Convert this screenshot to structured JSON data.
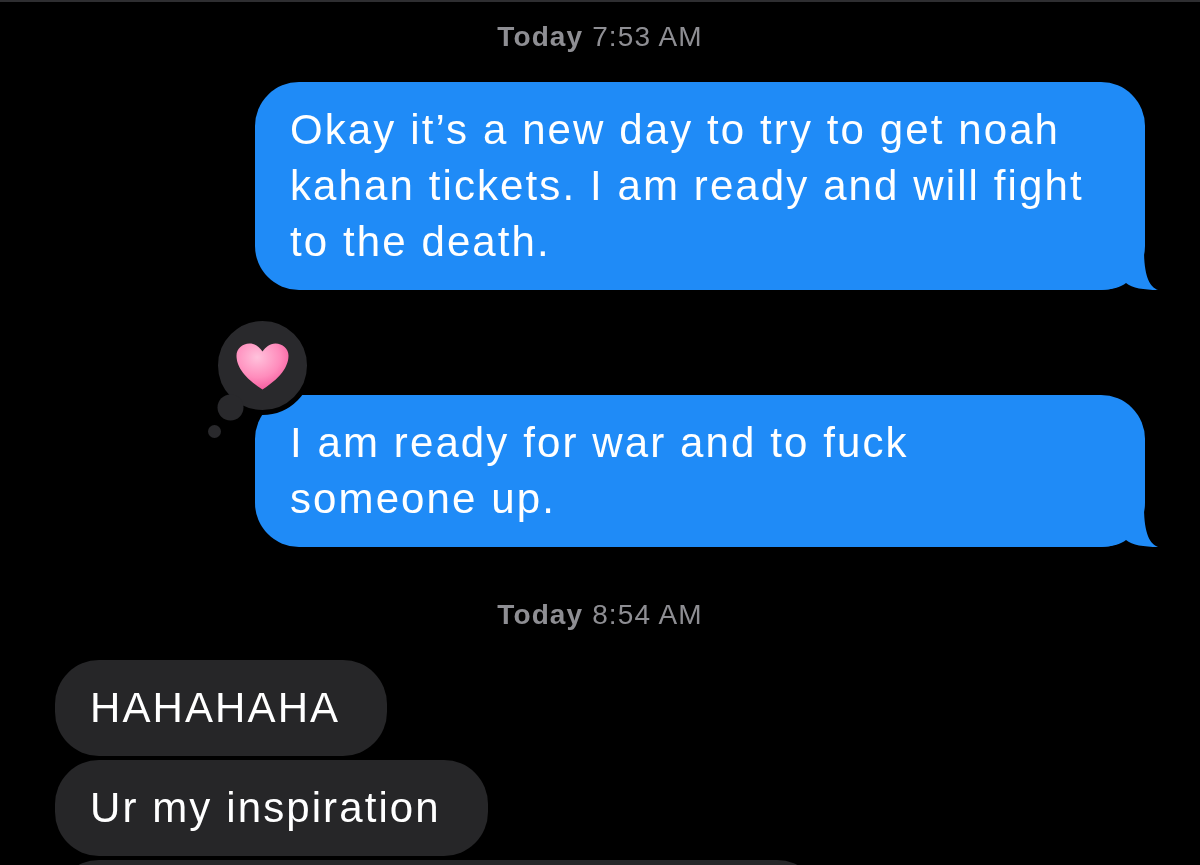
{
  "thread": [
    {
      "kind": "timestamp",
      "text": "**Today** 7:53 AM"
    },
    {
      "kind": "outgoing",
      "text": "Okay it’s a new day to try to get noah kahan tickets. I am ready and will fight to the death.",
      "tail": true,
      "reacted": false
    },
    {
      "kind": "outgoing",
      "text": "I am ready for war and to fuck someone up.",
      "tail": true,
      "reacted": true
    },
    {
      "kind": "timestamp",
      "text": "**Today** 8:54 AM"
    },
    {
      "kind": "incoming",
      "text": "HAHAHAHA",
      "tail": false,
      "reacted": false
    },
    {
      "kind": "incoming",
      "text": "Ur my inspiration",
      "tail": false,
      "reacted": false
    },
    {
      "kind": "incoming",
      "tail": false,
      "reacted": false
    }
  ]
}
